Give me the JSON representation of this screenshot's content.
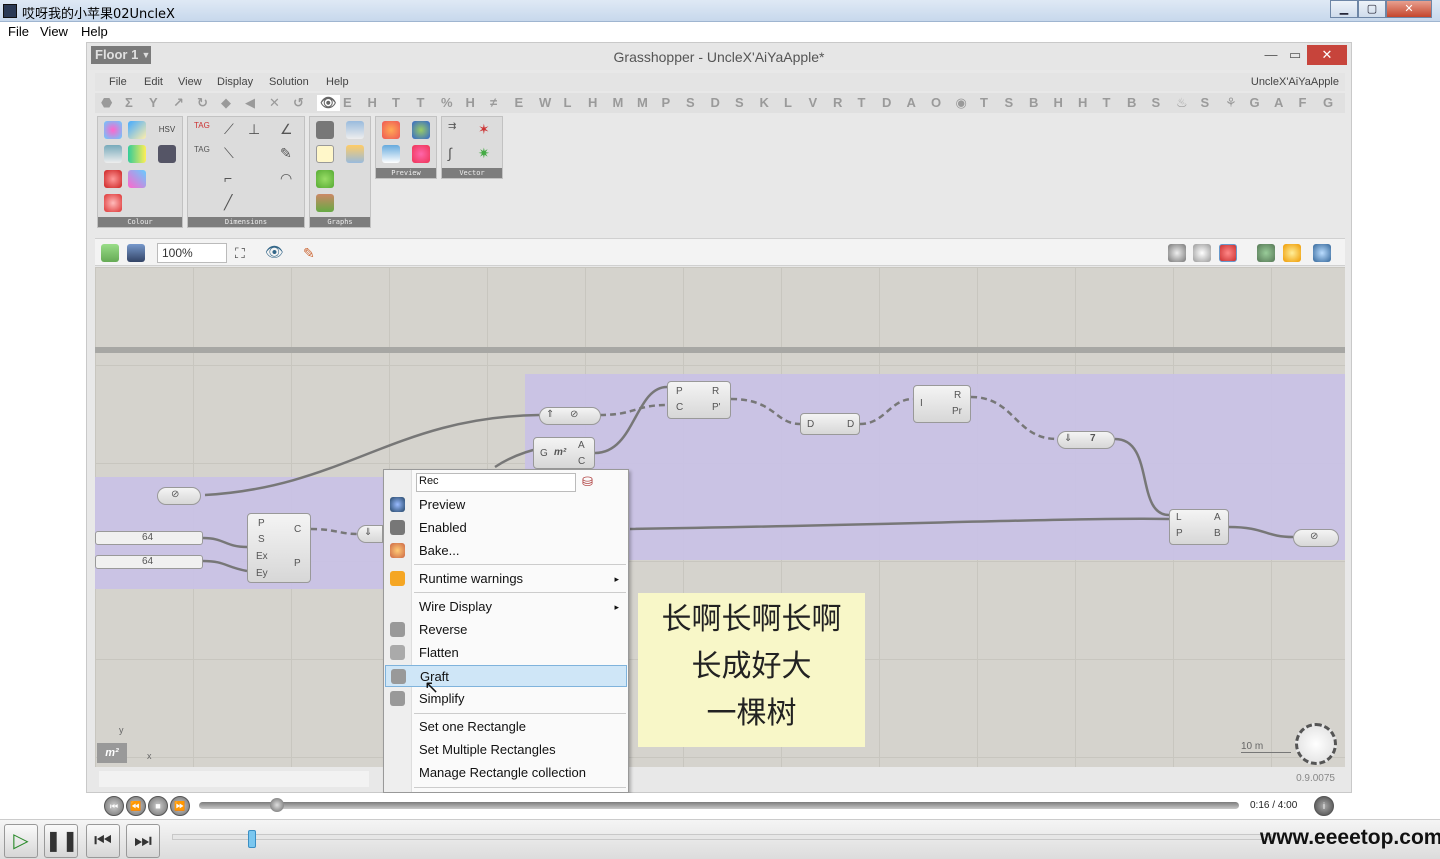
{
  "player": {
    "title": "哎呀我的小苹果02UncleX",
    "menu": [
      "File",
      "View",
      "Help"
    ],
    "time": "0:16 / 4:00",
    "progress_fraction": 0.067,
    "watermark": "www.eeeetop.com"
  },
  "gh": {
    "floor_label": "Floor 1",
    "title": "Grasshopper - UncleX'AiYaApple*",
    "menu": [
      "File",
      "Edit",
      "View",
      "Display",
      "Solution",
      "Help"
    ],
    "user": "UncleX'AiYaApple",
    "tabs": [
      "E",
      "H",
      "T",
      "T",
      "%",
      "H",
      "≠",
      "E",
      "W",
      "L",
      "H",
      "M",
      "M",
      "P",
      "S",
      "D",
      "S",
      "K",
      "L",
      "V",
      "R",
      "T",
      "D",
      "A",
      "O",
      "◉",
      "T",
      "S",
      "B",
      "H",
      "H",
      "T",
      "B",
      "S",
      "♨",
      "S",
      "⚘",
      "G",
      "A",
      "F",
      "G"
    ],
    "panels": [
      "Colour",
      "Dimensions",
      "Graphs",
      "Preview",
      "Vector"
    ],
    "zoom": "100%",
    "version": "0.9.0075",
    "scale_label": "10 m",
    "slider_value": "64",
    "area_glyph": "m²"
  },
  "context_menu": {
    "name_field": "Rec",
    "items": {
      "preview": "Preview",
      "enabled": "Enabled",
      "bake": "Bake...",
      "runtime_warnings": "Runtime warnings",
      "wire_display": "Wire Display",
      "reverse": "Reverse",
      "flatten": "Flatten",
      "graft": "Graft",
      "simplify": "Simplify",
      "set_one": "Set one Rectangle",
      "set_multiple": "Set Multiple Rectangles",
      "manage": "Manage Rectangle collection"
    }
  },
  "note": {
    "line1": "长啊长啊长啊",
    "line2": "长成好大",
    "line3": "一棵树"
  },
  "colors": {
    "group_fill": "#c9c1e6",
    "canvas": "#d5d3cd",
    "highlight": "#cfe6f7"
  }
}
